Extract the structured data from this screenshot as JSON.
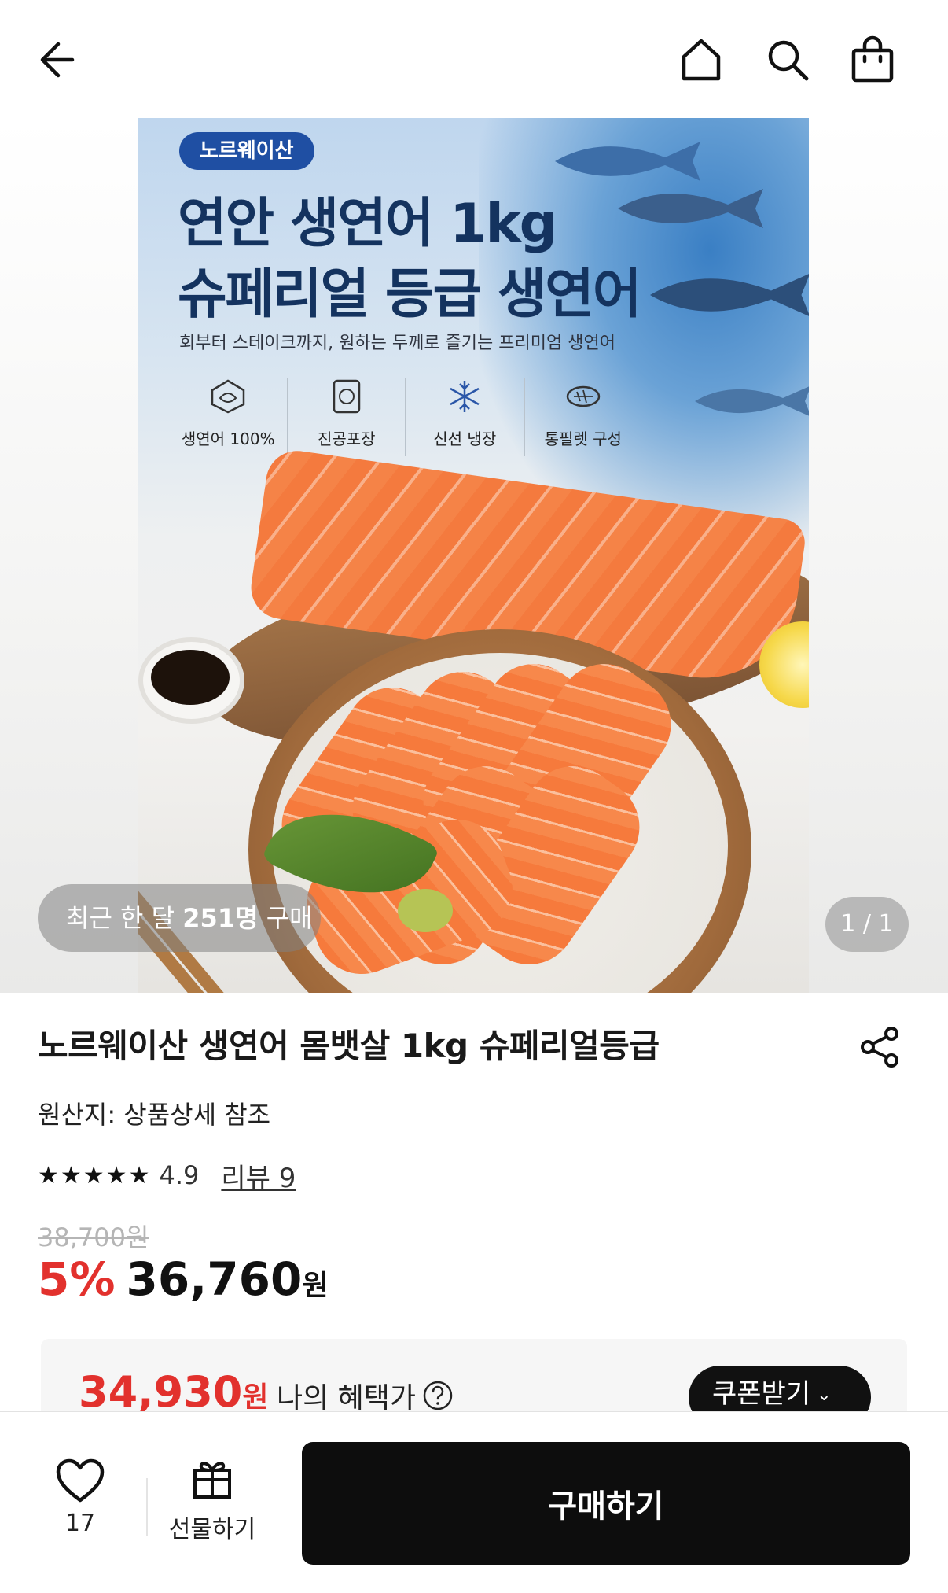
{
  "nav": {
    "back_icon": "back-arrow-icon",
    "home_icon": "home-icon",
    "search_icon": "search-icon",
    "cart_icon": "shopping-bag-icon"
  },
  "hero": {
    "brand": "노르웨이산",
    "headline_line1": "연안 생연어 1kg",
    "headline_line2": "슈페리얼 등급 생연어",
    "subline": "회부터 스테이크까지, 원하는 두께로 즐기는 프리미엄 생연어",
    "features": [
      {
        "icon": "salmon-badge-icon",
        "label": "생연어 100%"
      },
      {
        "icon": "vacuum-pack-icon",
        "label": "진공포장"
      },
      {
        "icon": "snowflake-icon",
        "label": "신선 냉장"
      },
      {
        "icon": "fish-fillet-icon",
        "label": "통필렛 구성"
      }
    ],
    "recent_prefix": "최근 한 달 ",
    "recent_count": "251명",
    "recent_suffix": " 구매",
    "page_indicator": "1 / 1"
  },
  "product": {
    "title": "노르웨이산 생연어 몸뱃살 1kg 슈페리얼등급",
    "origin": "원산지: 상품상세 참조",
    "stars": "★★★★★",
    "rating": 4.9,
    "rating_text": "4.9",
    "review_link": "리뷰 9",
    "original_price": "38,700원",
    "discount": "5%",
    "price": "36,760",
    "currency": "원"
  },
  "benefit": {
    "price": "34,930",
    "currency": "원",
    "label": "나의 혜택가",
    "coupon_button": "쿠폰받기"
  },
  "bottom_bar": {
    "like_count": "17",
    "gift_label": "선물하기",
    "buy_label": "구매하기"
  },
  "colors": {
    "discount_red": "#e2312d",
    "buy_button": "#0d0d0d",
    "brand_blue": "#1f4fa3"
  }
}
